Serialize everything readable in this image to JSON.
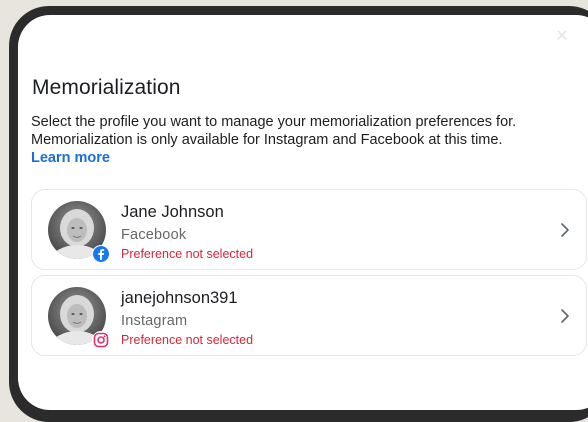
{
  "page": {
    "title": "Memorialization",
    "description_line1": "Select the profile you want to manage your memorialization preferences for.",
    "description_line2": "Memorialization is only available for Instagram and Facebook at this time.",
    "learn_more": "Learn more"
  },
  "profiles": [
    {
      "name": "Jane Johnson",
      "platform": "Facebook",
      "status": "Preference not selected",
      "badge_icon": "facebook-icon"
    },
    {
      "name": "janejohnson391",
      "platform": "Instagram",
      "status": "Preference not selected",
      "badge_icon": "instagram-icon"
    }
  ],
  "colors": {
    "link": "#1a6ed8",
    "status": "#d6253a",
    "facebook": "#1877f2",
    "instagram": "#e1306c"
  }
}
